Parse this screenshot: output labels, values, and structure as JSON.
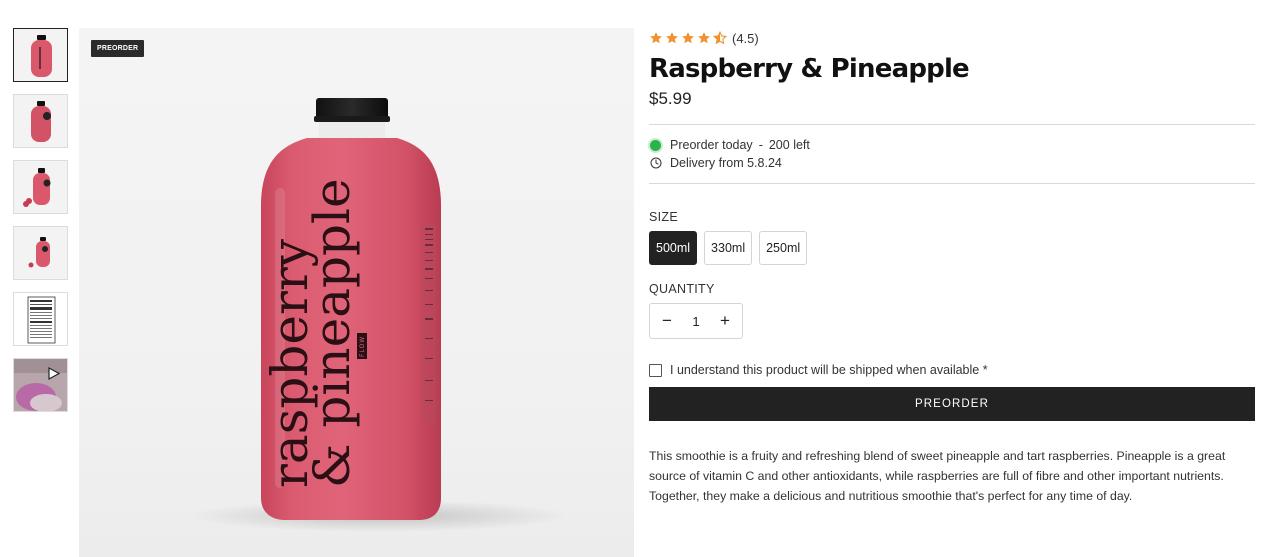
{
  "gallery": {
    "badge": "PREORDER",
    "thumbnails": [
      {
        "icon": "bottle-front-thumb"
      },
      {
        "icon": "bottle-angle-thumb"
      },
      {
        "icon": "bottle-fruit-thumb"
      },
      {
        "icon": "bottle-pair-thumb"
      },
      {
        "icon": "nutrition-label-thumb"
      },
      {
        "icon": "video-thumb"
      }
    ],
    "bottle_text_line1": "raspberry",
    "bottle_text_line2": "& pineapple",
    "bottle_brand": "FLOW"
  },
  "product": {
    "rating_value": 4.5,
    "rating_text": "(4.5)",
    "title": "Raspberry & Pineapple",
    "price": "$5.99",
    "status_text": "Preorder today",
    "stock_text": "200 left",
    "delivery_text": "Delivery from 5.8.24",
    "size_label": "SIZE",
    "sizes": [
      "500ml",
      "330ml",
      "250ml"
    ],
    "selected_size": "500ml",
    "quantity_label": "QUANTITY",
    "quantity": "1",
    "minus": "−",
    "plus": "+",
    "agree_text": "I understand this product will be shipped when available *",
    "button_label": "PREORDER",
    "description": "This smoothie is a fruity and refreshing blend of sweet pineapple and tart raspberries. Pineapple is a great source of vitamin C and other antioxidants, while raspberries are full of fibre and other important nutrients. Together, they make a delicious and nutritious smoothie that's perfect for any time of day."
  },
  "colors": {
    "star": "#f0922d",
    "bottle": "#d9586b",
    "status_dot": "#2eb34a",
    "button_bg": "#222222"
  }
}
